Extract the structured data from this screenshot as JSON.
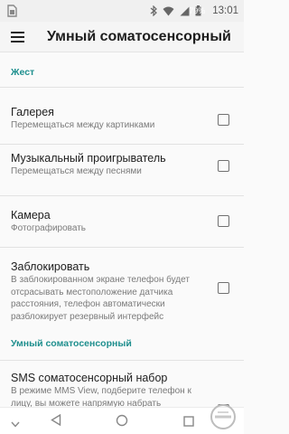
{
  "status_bar": {
    "battery_percent": "79%",
    "time": "13:01"
  },
  "app_bar": {
    "title": "Умный соматосенсорный"
  },
  "sections": [
    {
      "header": "Жест",
      "items": [
        {
          "title": "Галерея",
          "subtitle": "Перемещаться между картинками",
          "checked": false
        },
        {
          "title": "Музыкальный проигрыватель",
          "subtitle": "Перемещаться между песнями",
          "checked": false
        },
        {
          "title": "Камера",
          "subtitle": "Фотографировать",
          "checked": false
        },
        {
          "title": "Заблокировать",
          "subtitle": "В заблокированном экране телефон будет отсрасывать местоположение датчика расстояния, телефон автоматически разблокирует резервный интерфейс",
          "checked": false
        }
      ]
    },
    {
      "header": "Умный соматосенсорный",
      "items": [
        {
          "title": "SMS соматосенсорный набор",
          "subtitle": "В режиме MMS View, подберите телефон к лицу, вы можете напрямую набрать",
          "checked": false
        }
      ]
    }
  ],
  "icons": {
    "menu": "hamburger-menu-icon",
    "back": "back-triangle-icon",
    "home": "home-circle-icon",
    "recents": "recents-square-icon",
    "down": "chevron-down-icon"
  }
}
